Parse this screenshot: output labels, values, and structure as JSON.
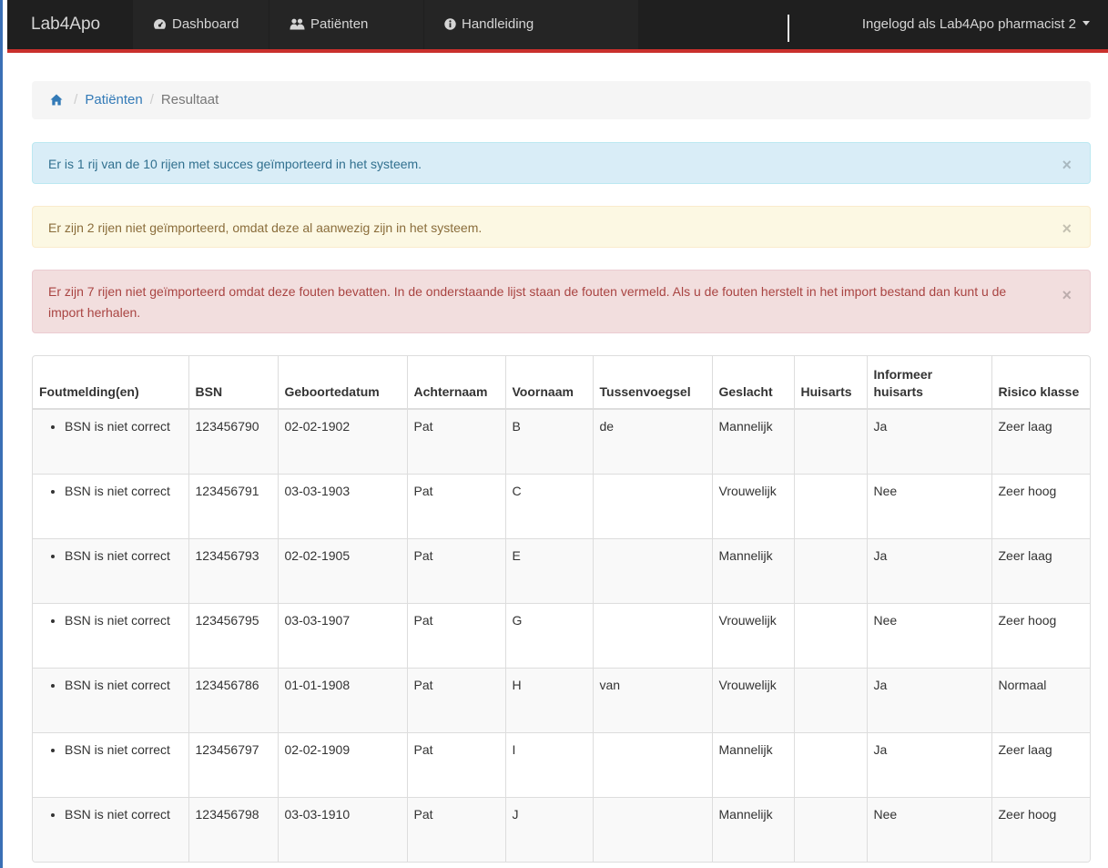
{
  "navbar": {
    "brand": "Lab4Apo",
    "items": [
      {
        "label": "Dashboard",
        "icon": "dashboard-icon"
      },
      {
        "label": "Patiënten",
        "icon": "users-icon"
      },
      {
        "label": "Handleiding",
        "icon": "info-icon"
      }
    ],
    "user_label": "Ingelogd als Lab4Apo pharmacist 2",
    "accent_color": "#c9302c"
  },
  "breadcrumb": {
    "home_icon": "home-icon",
    "items": [
      "Patiënten",
      "Resultaat"
    ]
  },
  "alerts": {
    "info": "Er is 1 rij van de 10 rijen met succes geïmporteerd in het systeem.",
    "warning": "Er zijn 2 rijen niet geïmporteerd, omdat deze al aanwezig zijn in het systeem.",
    "danger": "Er zijn 7 rijen niet geïmporteerd omdat deze fouten bevatten. In de onderstaande lijst staan de fouten vermeld. Als u de fouten herstelt in het import bestand dan kunt u de import herhalen.",
    "close_symbol": "×"
  },
  "table": {
    "headers": [
      "Foutmelding(en)",
      "BSN",
      "Geboortedatum",
      "Achternaam",
      "Voornaam",
      "Tussenvoegsel",
      "Geslacht",
      "Huisarts",
      "Informeer huisarts",
      "Risico klasse"
    ],
    "rows": [
      {
        "error": "BSN is niet correct",
        "bsn": "123456790",
        "dob": "02-02-1902",
        "lastname": "Pat",
        "firstname": "B",
        "infix": "de",
        "gender": "Mannelijk",
        "gp": "",
        "inform_gp": "Ja",
        "risk": "Zeer laag"
      },
      {
        "error": "BSN is niet correct",
        "bsn": "123456791",
        "dob": "03-03-1903",
        "lastname": "Pat",
        "firstname": "C",
        "infix": "",
        "gender": "Vrouwelijk",
        "gp": "",
        "inform_gp": "Nee",
        "risk": "Zeer hoog"
      },
      {
        "error": "BSN is niet correct",
        "bsn": "123456793",
        "dob": "02-02-1905",
        "lastname": "Pat",
        "firstname": "E",
        "infix": "",
        "gender": "Mannelijk",
        "gp": "",
        "inform_gp": "Ja",
        "risk": "Zeer laag"
      },
      {
        "error": "BSN is niet correct",
        "bsn": "123456795",
        "dob": "03-03-1907",
        "lastname": "Pat",
        "firstname": "G",
        "infix": "",
        "gender": "Vrouwelijk",
        "gp": "",
        "inform_gp": "Nee",
        "risk": "Zeer hoog"
      },
      {
        "error": "BSN is niet correct",
        "bsn": "123456786",
        "dob": "01-01-1908",
        "lastname": "Pat",
        "firstname": "H",
        "infix": "van",
        "gender": "Vrouwelijk",
        "gp": "",
        "inform_gp": "Ja",
        "risk": "Normaal"
      },
      {
        "error": "BSN is niet correct",
        "bsn": "123456797",
        "dob": "02-02-1909",
        "lastname": "Pat",
        "firstname": "I",
        "infix": "",
        "gender": "Mannelijk",
        "gp": "",
        "inform_gp": "Ja",
        "risk": "Zeer laag"
      },
      {
        "error": "BSN is niet correct",
        "bsn": "123456798",
        "dob": "03-03-1910",
        "lastname": "Pat",
        "firstname": "J",
        "infix": "",
        "gender": "Mannelijk",
        "gp": "",
        "inform_gp": "Nee",
        "risk": "Zeer hoog"
      }
    ]
  }
}
